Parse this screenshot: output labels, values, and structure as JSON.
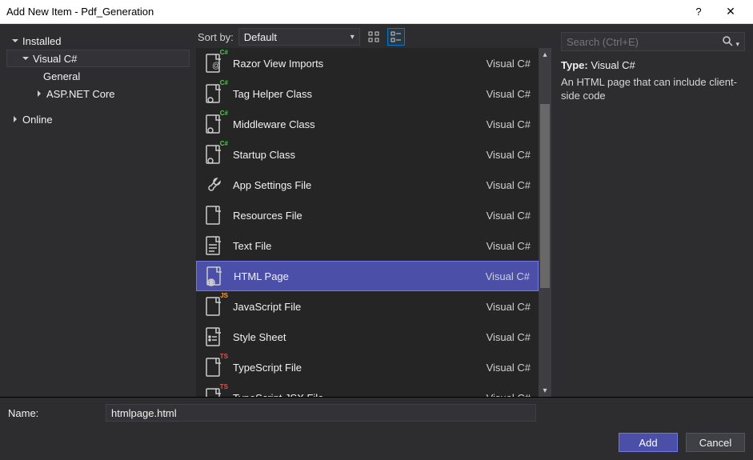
{
  "window": {
    "title": "Add New Item - Pdf_Generation",
    "help": "?",
    "close": "✕"
  },
  "sidebar": {
    "installed": "Installed",
    "csharp": "Visual C#",
    "general": "General",
    "aspnet": "ASP.NET Core",
    "online": "Online"
  },
  "toolbar": {
    "sortby": "Sort by:",
    "sort_value": "Default"
  },
  "items": [
    {
      "name": "Razor View Imports",
      "lang": "Visual C#",
      "badge": "C#",
      "badgeClass": "badge-cs",
      "icon": "page-at"
    },
    {
      "name": "Tag Helper Class",
      "lang": "Visual C#",
      "badge": "C#",
      "badgeClass": "badge-cs",
      "icon": "page-gear"
    },
    {
      "name": "Middleware Class",
      "lang": "Visual C#",
      "badge": "C#",
      "badgeClass": "badge-cs",
      "icon": "page-gear"
    },
    {
      "name": "Startup Class",
      "lang": "Visual C#",
      "badge": "C#",
      "badgeClass": "badge-cs",
      "icon": "page-gear"
    },
    {
      "name": "App Settings File",
      "lang": "Visual C#",
      "badge": "",
      "badgeClass": "",
      "icon": "wrench"
    },
    {
      "name": "Resources File",
      "lang": "Visual C#",
      "badge": "",
      "badgeClass": "",
      "icon": "page"
    },
    {
      "name": "Text File",
      "lang": "Visual C#",
      "badge": "",
      "badgeClass": "",
      "icon": "page-lines"
    },
    {
      "name": "HTML Page",
      "lang": "Visual C#",
      "badge": "",
      "badgeClass": "",
      "icon": "page-globe",
      "selected": true
    },
    {
      "name": "JavaScript File",
      "lang": "Visual C#",
      "badge": "JS",
      "badgeClass": "badge-js",
      "icon": "page"
    },
    {
      "name": "Style Sheet",
      "lang": "Visual C#",
      "badge": "",
      "badgeClass": "",
      "icon": "page-dots"
    },
    {
      "name": "TypeScript File",
      "lang": "Visual C#",
      "badge": "TS",
      "badgeClass": "badge-ts",
      "icon": "page"
    },
    {
      "name": "TypeScript JSX File",
      "lang": "Visual C#",
      "badge": "TS",
      "badgeClass": "badge-ts",
      "icon": "page"
    }
  ],
  "search": {
    "placeholder": "Search (Ctrl+E)"
  },
  "detail": {
    "type_label": "Type:",
    "type_value": "Visual C#",
    "description": "An HTML page that can include client-side code"
  },
  "name_row": {
    "label": "Name:",
    "value": "htmlpage.html"
  },
  "buttons": {
    "add": "Add",
    "cancel": "Cancel"
  }
}
